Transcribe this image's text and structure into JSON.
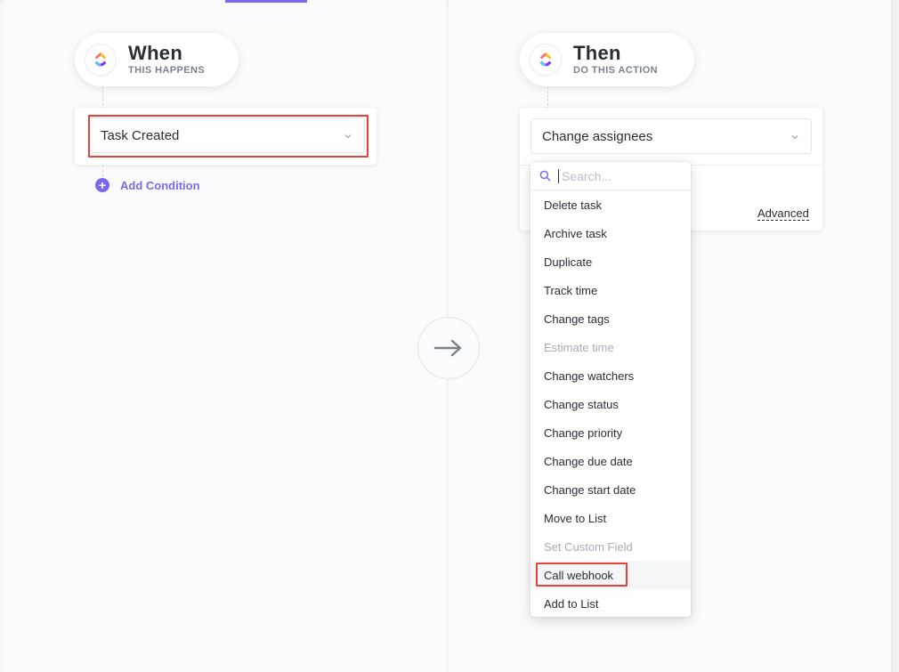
{
  "trigger": {
    "title": "When",
    "subtitle": "THIS HAPPENS",
    "selected": "Task Created",
    "add_condition_label": "Add Condition"
  },
  "action": {
    "title": "Then",
    "subtitle": "DO THIS ACTION",
    "selected": "Change assignees",
    "advanced_label": "Advanced"
  },
  "dropdown": {
    "search_placeholder": "Search...",
    "items": [
      {
        "label": "Delete task",
        "disabled": false
      },
      {
        "label": "Archive task",
        "disabled": false
      },
      {
        "label": "Duplicate",
        "disabled": false
      },
      {
        "label": "Track time",
        "disabled": false
      },
      {
        "label": "Change tags",
        "disabled": false
      },
      {
        "label": "Estimate time",
        "disabled": true
      },
      {
        "label": "Change watchers",
        "disabled": false
      },
      {
        "label": "Change status",
        "disabled": false
      },
      {
        "label": "Change priority",
        "disabled": false
      },
      {
        "label": "Change due date",
        "disabled": false
      },
      {
        "label": "Change start date",
        "disabled": false
      },
      {
        "label": "Move to List",
        "disabled": false
      },
      {
        "label": "Set Custom Field",
        "disabled": true
      },
      {
        "label": "Call webhook",
        "disabled": false,
        "highlighted": true
      },
      {
        "label": "Add to List",
        "disabled": false
      }
    ]
  },
  "colors": {
    "accent": "#7b68ee",
    "highlight_box": "#e8433a",
    "disabled_text": "#a8adb5"
  },
  "icons": {
    "logo": "clickup-logo-icon",
    "chevron": "chevron-down-icon",
    "plus": "plus-circle-icon",
    "arrow": "arrow-right-icon",
    "search": "search-icon"
  }
}
